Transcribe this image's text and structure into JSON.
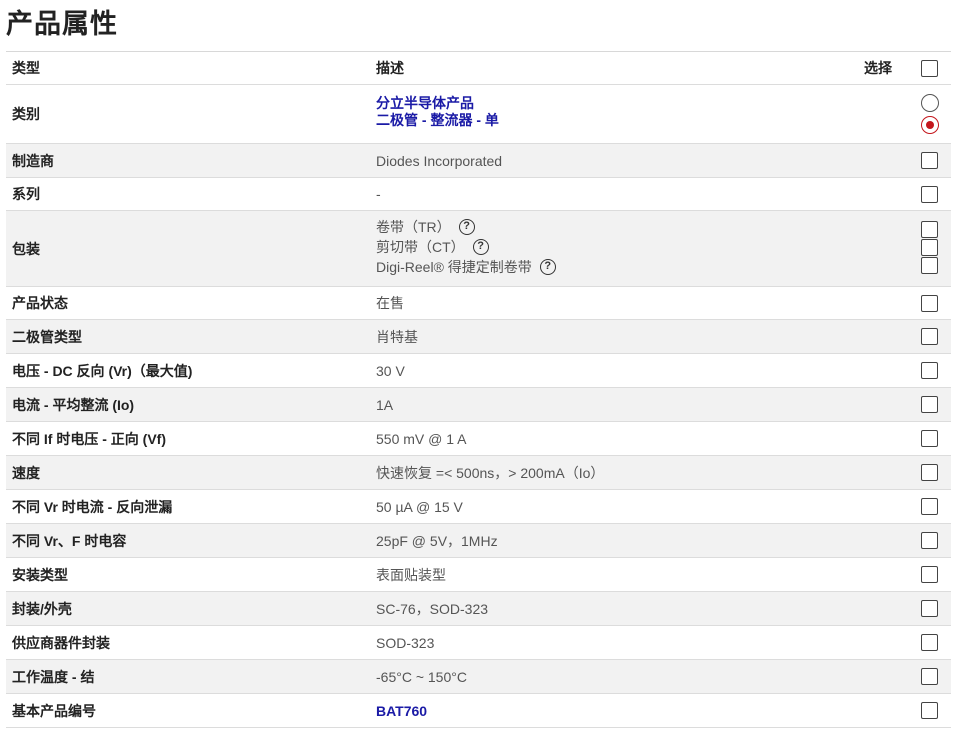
{
  "page_title": "产品属性",
  "header": {
    "type": "类型",
    "desc": "描述",
    "select": "选择"
  },
  "rows": [
    {
      "label": "类别",
      "lines": [
        "分立半导体产品",
        "二极管 - 整流器 - 单"
      ]
    },
    {
      "label": "制造商",
      "value": "Diodes Incorporated"
    },
    {
      "label": "系列",
      "value": "-"
    },
    {
      "label": "包装",
      "lines": [
        "卷带（TR）",
        "剪切带（CT）",
        "Digi-Reel® 得捷定制卷带"
      ]
    },
    {
      "label": "产品状态",
      "value": "在售"
    },
    {
      "label": "二极管类型",
      "value": "肖特基"
    },
    {
      "label": "电压 - DC 反向 (Vr)（最大值)",
      "value": "30 V"
    },
    {
      "label": "电流 - 平均整流 (Io)",
      "value": "1A"
    },
    {
      "label": "不同 If 时电压 - 正向 (Vf)",
      "value": "550 mV @ 1 A"
    },
    {
      "label": "速度",
      "value": "快速恢复 =< 500ns，> 200mA（Io）"
    },
    {
      "label": "不同 Vr 时电流 - 反向泄漏",
      "value": "50 µA @ 15 V"
    },
    {
      "label": "不同 Vr、F 时电容",
      "value": "25pF @ 5V，1MHz"
    },
    {
      "label": "安装类型",
      "value": "表面贴装型"
    },
    {
      "label": "封装/外壳",
      "value": "SC-76，SOD-323"
    },
    {
      "label": "供应商器件封装",
      "value": "SOD-323"
    },
    {
      "label": "工作温度 - 结",
      "value": "-65°C ~ 150°C"
    },
    {
      "label": "基本产品编号",
      "value": "BAT760"
    }
  ],
  "help_glyph": "?",
  "icons": {
    "help": "question-circle-icon",
    "radio": "radio-icon",
    "checkbox": "checkbox-icon"
  },
  "colors": {
    "link": "#1a1aa6",
    "radio_checked": "#c4161c",
    "alt_row": "#f2f2f2"
  }
}
